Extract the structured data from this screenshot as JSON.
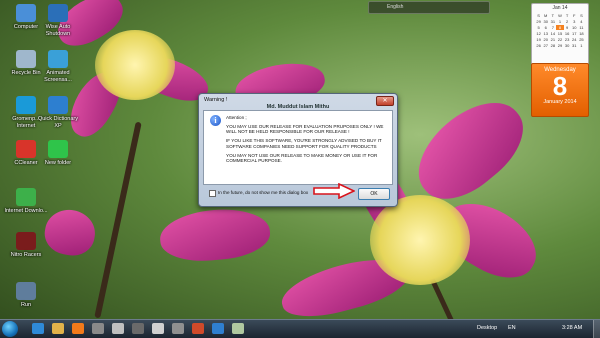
{
  "desktop": {
    "icons": [
      {
        "label": "Computer",
        "icon": "computer-icon",
        "color": "#4a8fd8"
      },
      {
        "label": "Wise Auto Shutdown",
        "icon": "clock-icon",
        "color": "#2b6fb8"
      },
      {
        "label": "Recycle Bin",
        "icon": "recycle-bin-icon",
        "color": "#9fb7cc"
      },
      {
        "label": "Animated Screensa...",
        "icon": "screensaver-icon",
        "color": "#3aa0d8"
      },
      {
        "label": "Gromenp... Internet",
        "icon": "globe-icon",
        "color": "#1a9ad8"
      },
      {
        "label": "Quick Dictionary XP",
        "icon": "dictionary-icon",
        "color": "#2d7fd0"
      },
      {
        "label": "CCleaner",
        "icon": "ccleaner-icon",
        "color": "#d8342a"
      },
      {
        "label": "New folder",
        "icon": "folder-icon",
        "color": "#2fc44a"
      },
      {
        "label": "Internet Downlo...",
        "icon": "download-icon",
        "color": "#3db04a"
      },
      {
        "label": "Nitro Racers",
        "icon": "game-icon",
        "color": "#7a1c1c"
      },
      {
        "label": "Run",
        "icon": "run-icon",
        "color": "#5f7d9c"
      }
    ]
  },
  "gadgets": {
    "top_bar_label": "English",
    "calendar": {
      "month": "Jan 14",
      "weekdays": [
        "S",
        "M",
        "T",
        "W",
        "T",
        "F",
        "S"
      ],
      "days": [
        "29",
        "30",
        "31",
        "1",
        "2",
        "3",
        "4",
        "5",
        "6",
        "7",
        "8",
        "9",
        "10",
        "11",
        "12",
        "13",
        "14",
        "15",
        "16",
        "17",
        "18",
        "19",
        "20",
        "21",
        "22",
        "23",
        "24",
        "25",
        "26",
        "27",
        "28",
        "29",
        "30",
        "31",
        "1"
      ],
      "selected_day": "8"
    },
    "day_page": {
      "weekday": "Wednesday",
      "day": "8",
      "month_year": "January 2014"
    }
  },
  "dialog": {
    "title": "Warning !",
    "close_label": "✕",
    "heading": "Md. Muddut Islam Mithu",
    "attention": "Attention ;",
    "paragraphs": [
      "YOU MAY USE OUR RELEASE FOR EVALUATION PRUPOSES ONLY ! WE WILL NOT BE HELD  RESPONSIBLE  FOR OUR  RELEASE !",
      "IF YOU LIKE THIS SOFTWARE, YOU'RE STRONGLY ADVISED TO BUY IT SOFTWARE COMPANIES NEED SUPPORT FOR QUALITY PRODUCTS",
      "YOU MAY NOT USE OUR RELEASE TO MAKE MONEY OR USE IT FOR COMMERCIAL PURPOSE."
    ],
    "checkbox_label": "In the future, do not show me this dialog box",
    "ok_label": "OK"
  },
  "taskbar": {
    "pinned": [
      {
        "icon": "ie-icon",
        "color": "#2f8ad8"
      },
      {
        "icon": "explorer-icon",
        "color": "#e2b24a"
      },
      {
        "icon": "media-player-icon",
        "color": "#f27a1a"
      },
      {
        "icon": "app-icon",
        "color": "#8a8a8a"
      },
      {
        "icon": "app-icon",
        "color": "#c0c0c0"
      },
      {
        "icon": "app-icon",
        "color": "#6a6a6a"
      },
      {
        "icon": "app-icon",
        "color": "#d0d0d0"
      },
      {
        "icon": "app-icon",
        "color": "#909090"
      },
      {
        "icon": "app-icon",
        "color": "#d04a2a"
      },
      {
        "icon": "app-icon",
        "color": "#2f7fd0"
      },
      {
        "icon": "app-icon",
        "color": "#b0c8a0"
      }
    ],
    "desktop_label": "Desktop",
    "language": "EN",
    "time": "3:28 AM"
  }
}
